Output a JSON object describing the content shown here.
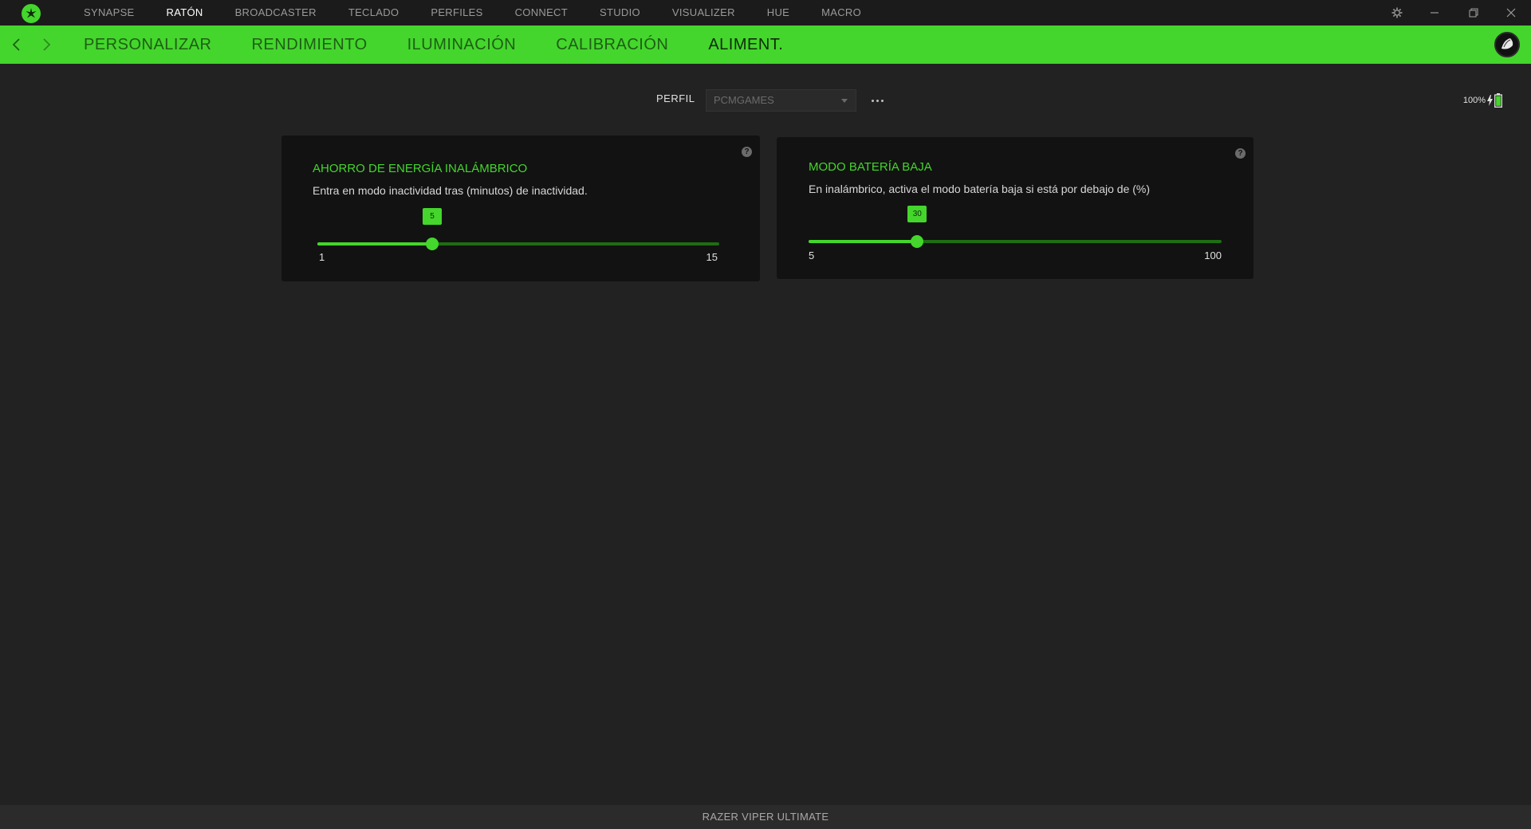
{
  "app": {
    "top_nav": [
      "SYNAPSE",
      "RATÓN",
      "BROADCASTER",
      "TECLADO",
      "PERFILES",
      "CONNECT",
      "STUDIO",
      "VISUALIZER",
      "HUE",
      "MACRO"
    ],
    "top_nav_active": "RATÓN",
    "accent_color": "#44d62c"
  },
  "subnav": {
    "tabs": [
      "PERSONALIZAR",
      "RENDIMIENTO",
      "ILUMINACIÓN",
      "CALIBRACIÓN",
      "ALIMENT."
    ],
    "active": "ALIMENT."
  },
  "profile": {
    "label": "PERFIL",
    "selected": "PCMGAMES"
  },
  "battery": {
    "percent_text": "100%",
    "level": 1.0,
    "charging": true
  },
  "cards": {
    "power_saving": {
      "title": "AHORRO DE ENERGÍA INALÁMBRICO",
      "description": "Entra en modo inactividad tras (minutos) de inactividad.",
      "min": 1,
      "max": 15,
      "value": 5,
      "min_label": "1",
      "max_label": "15",
      "value_label": "5"
    },
    "low_battery": {
      "title": "MODO BATERÍA BAJA",
      "description": "En inalámbrico, activa el modo batería baja si está por debajo de (%)",
      "min": 5,
      "max": 100,
      "value": 30,
      "min_label": "5",
      "max_label": "100",
      "value_label": "30"
    }
  },
  "status_bar": {
    "device_name": "RAZER VIPER ULTIMATE"
  }
}
